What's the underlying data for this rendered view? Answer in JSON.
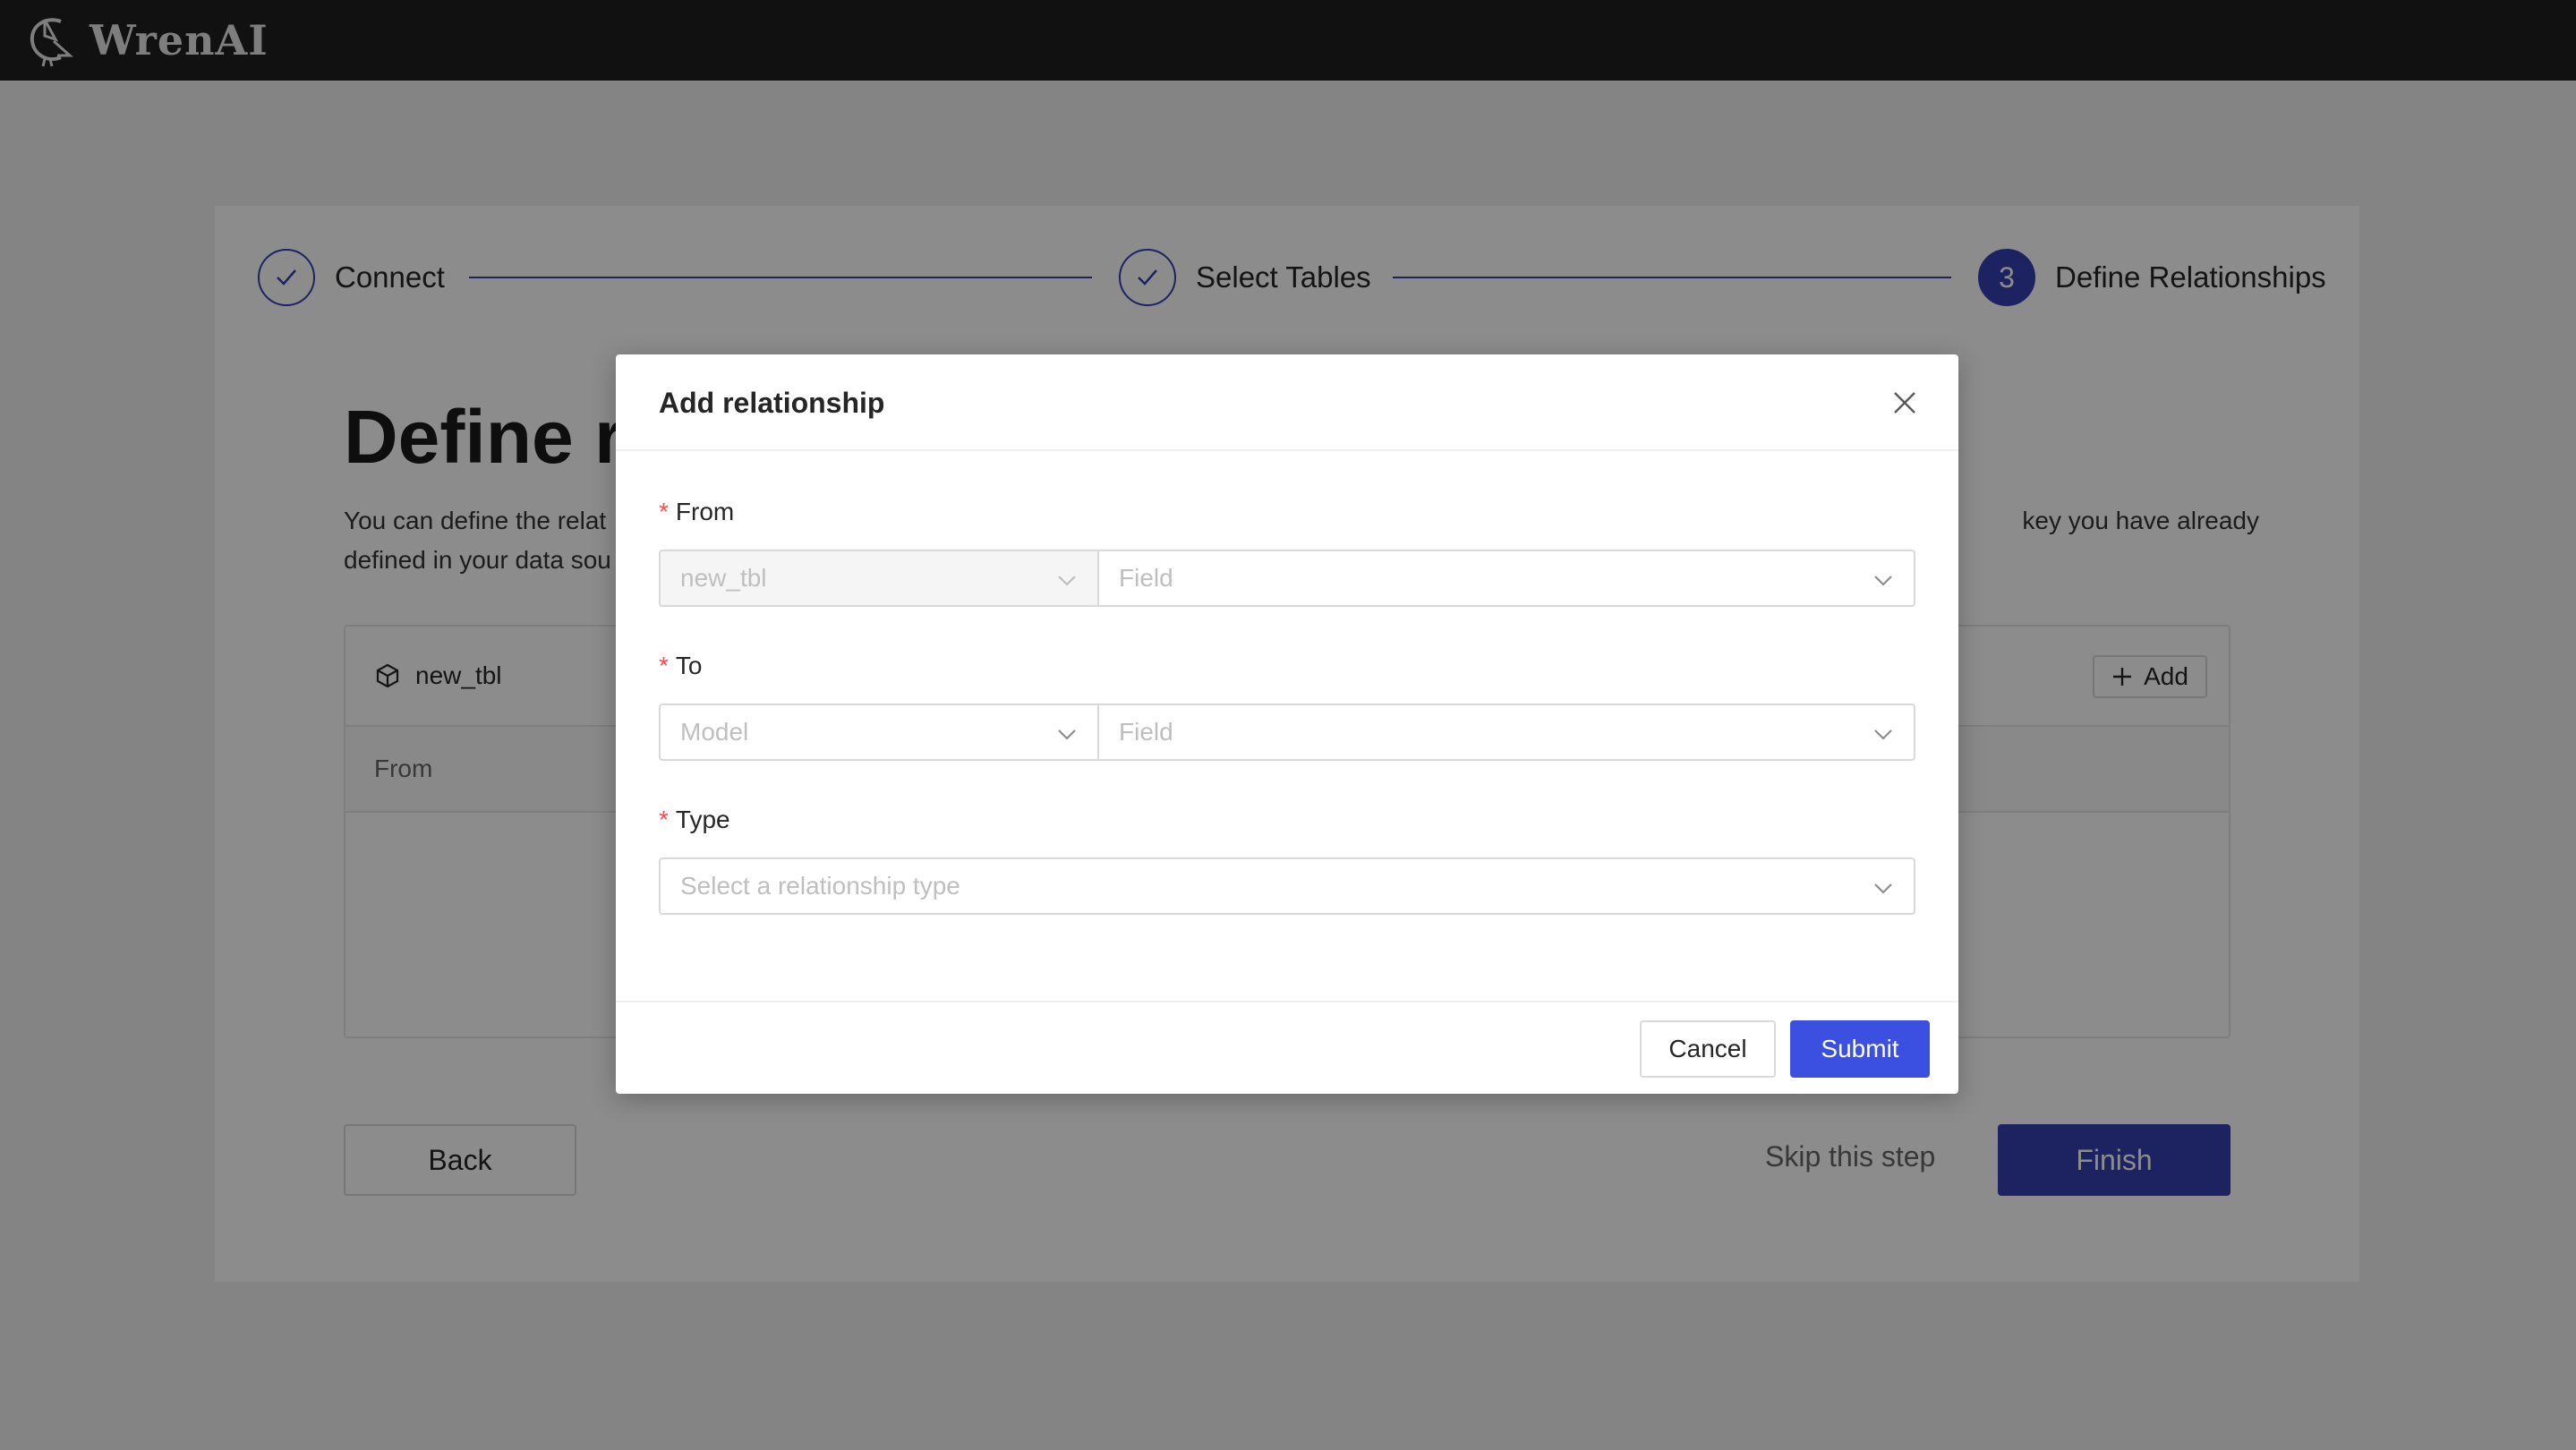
{
  "app": {
    "name": "WrenAI"
  },
  "steps": [
    {
      "label": "Connect",
      "status": "done"
    },
    {
      "label": "Select Tables",
      "status": "done"
    },
    {
      "label": "Define Relationships",
      "status": "active",
      "number": "3"
    }
  ],
  "page": {
    "title": "Define re",
    "description_line1": "You can define the relat",
    "description_line1_tail": "key you have already",
    "description_line2": "defined in your data sou",
    "model_name": "new_tbl",
    "add_label": "Add",
    "column_from": "From",
    "back_label": "Back",
    "skip_label": "Skip this step",
    "finish_label": "Finish"
  },
  "modal": {
    "title": "Add relationship",
    "from": {
      "label": "From",
      "model_value": "new_tbl",
      "field_placeholder": "Field"
    },
    "to": {
      "label": "To",
      "model_placeholder": "Model",
      "field_placeholder": "Field"
    },
    "type": {
      "label": "Type",
      "placeholder": "Select a relationship type"
    },
    "required_mark": "*",
    "cancel_label": "Cancel",
    "submit_label": "Submit"
  },
  "colors": {
    "primary": "#3341b0",
    "submit": "#3b4fe0",
    "required": "#ff4d4f",
    "topbar": "#1f1f1f"
  },
  "icons": [
    "wren-logo-icon",
    "check-icon",
    "model-cube-icon",
    "plus-icon",
    "close-icon",
    "chevron-down-icon"
  ]
}
